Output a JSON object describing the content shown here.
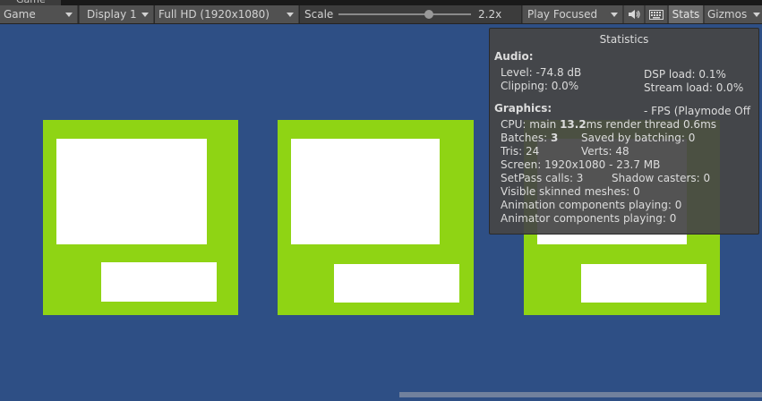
{
  "tab": {
    "label": "Game"
  },
  "toolbar": {
    "view_mode": "Game",
    "display": "Display 1",
    "resolution": "Full HD (1920x1080)",
    "scale_label": "Scale",
    "scale_value": "2.2x",
    "play_mode": "Play Focused",
    "stats_label": "Stats",
    "gizmos_label": "Gizmos"
  },
  "icons": {
    "audio": "speaker-icon",
    "keyboard": "keyboard-icon"
  },
  "colors": {
    "background": "#2e4f85",
    "card_green": "#8fd414",
    "card_white": "#ffffff",
    "overlay": "#464646"
  },
  "stats": {
    "title": "Statistics",
    "audio_header": "Audio:",
    "level": "Level: -74.8 dB",
    "dsp_load": "DSP load: 0.1%",
    "clipping": "Clipping: 0.0%",
    "stream_load": "Stream load: 0.0%",
    "graphics_header": "Graphics:",
    "fps": "- FPS (Playmode Off",
    "cpu_prefix": "CPU: main ",
    "cpu_main_value": "13.2",
    "cpu_suffix": "ms  render thread 0.6ms",
    "batches_prefix": "Batches: ",
    "batches_value": "3",
    "saved_by_batching": "Saved by batching: 0",
    "tris": "Tris: 24",
    "verts": "Verts: 48",
    "screen": "Screen: 1920x1080 - 23.7 MB",
    "setpass": "SetPass calls: 3",
    "shadow_casters": "Shadow casters: 0",
    "skinned_meshes": "Visible skinned meshes: 0",
    "animation_components": "Animation components playing: 0",
    "animator_components": "Animator components playing: 0"
  }
}
